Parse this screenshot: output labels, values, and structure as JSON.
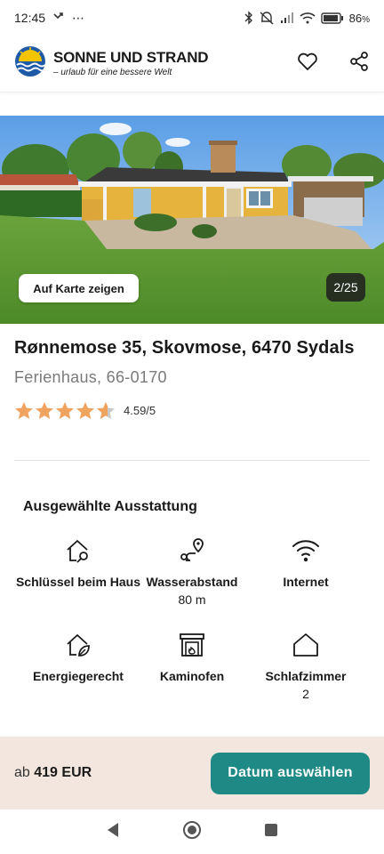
{
  "status_bar": {
    "time": "12:45",
    "overflow": "⋯",
    "battery_percent": "86",
    "battery_unit": "%"
  },
  "header": {
    "brand_name": "SONNE UND STRAND",
    "tagline": "– urlaub für eine bessere Welt"
  },
  "gallery": {
    "map_button_label": "Auf Karte zeigen",
    "counter": "2/25"
  },
  "listing": {
    "title": "Rønnemose 35, Skovmose, 6470 Sydals",
    "subtitle": "Ferienhaus, 66-0170",
    "rating_value": "4.59/5",
    "rating_fraction": 0.918
  },
  "features": {
    "title": "Ausgewählte Ausstattung",
    "items": [
      {
        "label": "Schlüssel beim Haus",
        "value": "",
        "icon": "house-key-icon"
      },
      {
        "label": "Wasserabstand",
        "value": "80 m",
        "icon": "route-pin-icon"
      },
      {
        "label": "Internet",
        "value": "",
        "icon": "wifi-icon"
      },
      {
        "label": "Energiegerecht",
        "value": "",
        "icon": "house-leaf-icon"
      },
      {
        "label": "Kaminofen",
        "value": "",
        "icon": "fireplace-icon"
      },
      {
        "label": "Schlafzimmer",
        "value": "2",
        "icon": "house-outline-icon"
      }
    ]
  },
  "booking": {
    "price_prefix": "ab",
    "price_amount": "419 EUR",
    "date_button_label": "Datum auswählen"
  },
  "colors": {
    "accent": "#1f8a85",
    "booking_bar_bg": "#f3e6de",
    "star": "#f0a35e",
    "subtitle": "#7a7a7a"
  }
}
